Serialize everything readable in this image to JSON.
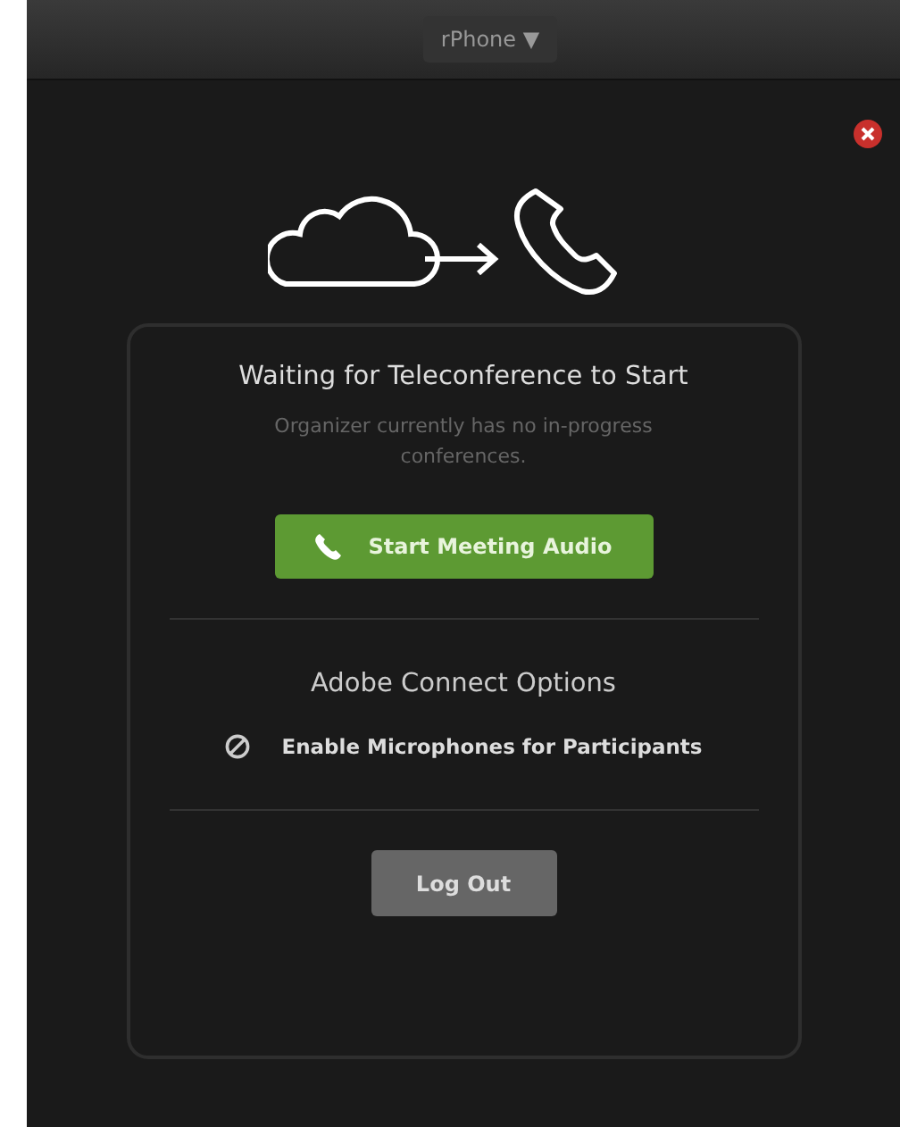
{
  "device_menu": {
    "label": "rPhone ▼"
  },
  "card": {
    "title": "Waiting for Teleconference to Start",
    "message": "Organizer currently has no in-progress conferences.",
    "primary_button": "Start Meeting Audio",
    "options_title": "Adobe Connect Options",
    "options": [
      {
        "label": "Enable Microphones for Participants",
        "enabled": false
      }
    ],
    "logout_button": "Log Out"
  }
}
